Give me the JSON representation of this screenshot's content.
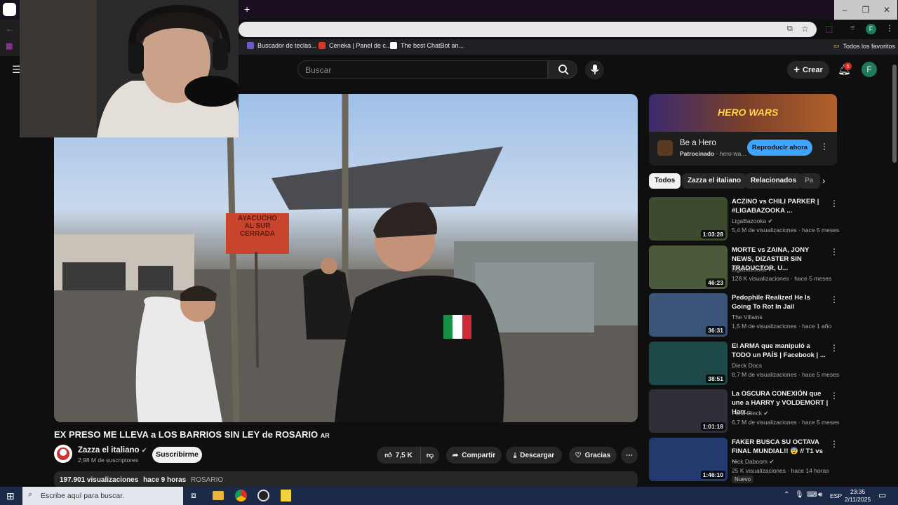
{
  "browser": {
    "new_tab": "+",
    "bookmarks": [
      {
        "label": "Buscador de teclas...",
        "color": "#6a5acd"
      },
      {
        "label": "Ceneka | Panel de c...",
        "color": "#d9352a"
      },
      {
        "label": "The best ChatBot an...",
        "color": "#ffffff"
      }
    ],
    "all_bookmarks": "Todos los favoritos",
    "profile_letter": "F"
  },
  "header": {
    "search_placeholder": "Buscar",
    "create_label": "Crear",
    "notifications_count": "5",
    "avatar_letter": "F"
  },
  "video": {
    "title": "EX PRESO ME LLEVA a LOS BARRIOS SIN LEY de ROSARIO",
    "title_flag": "AR",
    "sign_line1": "AYACUCHO",
    "sign_line2": "AL SUR",
    "sign_line3": "CERRADA",
    "channel": "Zazza el italiano",
    "subscribers": "2,98 M de suscriptores",
    "subscribe_label": "Suscribirme",
    "likes": "7,5 K",
    "share_label": "Compartir",
    "download_label": "Descargar",
    "thanks_label": "Gracias",
    "views": "197.901 visualizaciones",
    "age": "hace 9 horas",
    "tag": "ROSARIO"
  },
  "ad": {
    "banner_text": "HERO WARS",
    "title": "Be a Hero",
    "sponsored": "Patrocinado",
    "domain": "· hero-wa...",
    "cta": "Reproducir ahora"
  },
  "chips": [
    "Todos",
    "Zazza el italiano",
    "Relacionados",
    "Pa"
  ],
  "recommendations": [
    {
      "title": "ACZINO vs CHILI PARKER | #LIGABAZOOKA ...",
      "channel": "LigaBazooka",
      "meta": "5,4 M de visualizaciones · hace 5 meses",
      "duration": "1:03:28",
      "color": "#3c4a2e"
    },
    {
      "title": "MORTE vs ZAINA, JONY NEWS, DIZASTER SIN TRADUCTOR, U...",
      "channel": "LigaBazooka",
      "meta": "128 K visualizaciones · hace 5 meses",
      "duration": "46:23",
      "color": "#4b5a3a"
    },
    {
      "title": "Pedophile Realized He Is Going To Rot In Jail",
      "channel": "The Villains",
      "meta": "1,5 M de visualizaciones · hace 1 año",
      "duration": "36:31",
      "color": "#3b5578"
    },
    {
      "title": "El ARMA que manipuló a TODO un PAÍS | Facebook | ...",
      "channel": "Dieck Docs",
      "meta": "8,7 M de visualizaciones · hace 5 meses",
      "duration": "38:51",
      "color": "#1d4a48"
    },
    {
      "title": "La OSCURA CONEXIÓN que une a HARRY y VOLDEMORT | Harr...",
      "channel": "Farid Dieck",
      "meta": "6,7 M de visualizaciones · hace 5 meses",
      "duration": "1:01:18",
      "color": "#2f2f3a"
    },
    {
      "title": "FAKER BUSCA SU OCTAVA FINAL MUNDIAL!! 😨 // T1 vs ...",
      "channel": "Nick Daboom",
      "meta": "25 K visualizaciones · hace 14 horas",
      "duration": "1:46:10",
      "color": "#243a6e",
      "badge": "Nuevo"
    }
  ],
  "taskbar": {
    "search_placeholder": "Escribe aquí para buscar.",
    "lang": "ESP",
    "time": "23:35",
    "date": "2/11/2025"
  }
}
